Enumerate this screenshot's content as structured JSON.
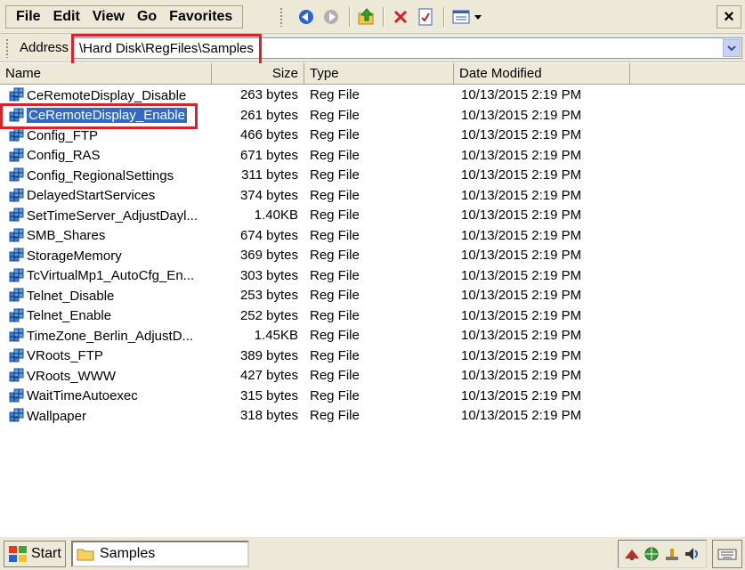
{
  "menu": {
    "file": "File",
    "edit": "Edit",
    "view": "View",
    "go": "Go",
    "favorites": "Favorites"
  },
  "toolbar": {
    "close_label": "×",
    "icons": [
      "back-icon",
      "forward-icon",
      "up-folder-icon",
      "delete-icon",
      "properties-icon",
      "views-icon"
    ]
  },
  "address": {
    "label": "Address",
    "value": "\\Hard Disk\\RegFiles\\Samples"
  },
  "columns": {
    "name": "Name",
    "size": "Size",
    "type": "Type",
    "date": "Date Modified"
  },
  "files": [
    {
      "name": "CeRemoteDisplay_Disable",
      "size": "263 bytes",
      "type": "Reg File",
      "date": "10/13/2015 2:19 PM"
    },
    {
      "name": "CeRemoteDisplay_Enable",
      "size": "261 bytes",
      "type": "Reg File",
      "date": "10/13/2015 2:19 PM",
      "selected": true
    },
    {
      "name": "Config_FTP",
      "size": "466 bytes",
      "type": "Reg File",
      "date": "10/13/2015 2:19 PM"
    },
    {
      "name": "Config_RAS",
      "size": "671 bytes",
      "type": "Reg File",
      "date": "10/13/2015 2:19 PM"
    },
    {
      "name": "Config_RegionalSettings",
      "size": "311 bytes",
      "type": "Reg File",
      "date": "10/13/2015 2:19 PM"
    },
    {
      "name": "DelayedStartServices",
      "size": "374 bytes",
      "type": "Reg File",
      "date": "10/13/2015 2:19 PM"
    },
    {
      "name": "SetTimeServer_AdjustDayl...",
      "size": "1.40KB",
      "type": "Reg File",
      "date": "10/13/2015 2:19 PM"
    },
    {
      "name": "SMB_Shares",
      "size": "674 bytes",
      "type": "Reg File",
      "date": "10/13/2015 2:19 PM"
    },
    {
      "name": "StorageMemory",
      "size": "369 bytes",
      "type": "Reg File",
      "date": "10/13/2015 2:19 PM"
    },
    {
      "name": "TcVirtualMp1_AutoCfg_En...",
      "size": "303 bytes",
      "type": "Reg File",
      "date": "10/13/2015 2:19 PM"
    },
    {
      "name": "Telnet_Disable",
      "size": "253 bytes",
      "type": "Reg File",
      "date": "10/13/2015 2:19 PM"
    },
    {
      "name": "Telnet_Enable",
      "size": "252 bytes",
      "type": "Reg File",
      "date": "10/13/2015 2:19 PM"
    },
    {
      "name": "TimeZone_Berlin_AdjustD...",
      "size": "1.45KB",
      "type": "Reg File",
      "date": "10/13/2015 2:19 PM"
    },
    {
      "name": "VRoots_FTP",
      "size": "389 bytes",
      "type": "Reg File",
      "date": "10/13/2015 2:19 PM"
    },
    {
      "name": "VRoots_WWW",
      "size": "427 bytes",
      "type": "Reg File",
      "date": "10/13/2015 2:19 PM"
    },
    {
      "name": "WaitTimeAutoexec",
      "size": "315 bytes",
      "type": "Reg File",
      "date": "10/13/2015 2:19 PM"
    },
    {
      "name": "Wallpaper",
      "size": "318 bytes",
      "type": "Reg File",
      "date": "10/13/2015 2:19 PM"
    }
  ],
  "taskbar": {
    "start_label": "Start",
    "window_label": "Samples",
    "tray_icons": [
      "network-icon",
      "globe-icon",
      "connection-icon",
      "volume-icon"
    ]
  },
  "colors": {
    "selection": "#316ac5",
    "annotation": "#d9232a",
    "chrome": "#ece9d8"
  }
}
